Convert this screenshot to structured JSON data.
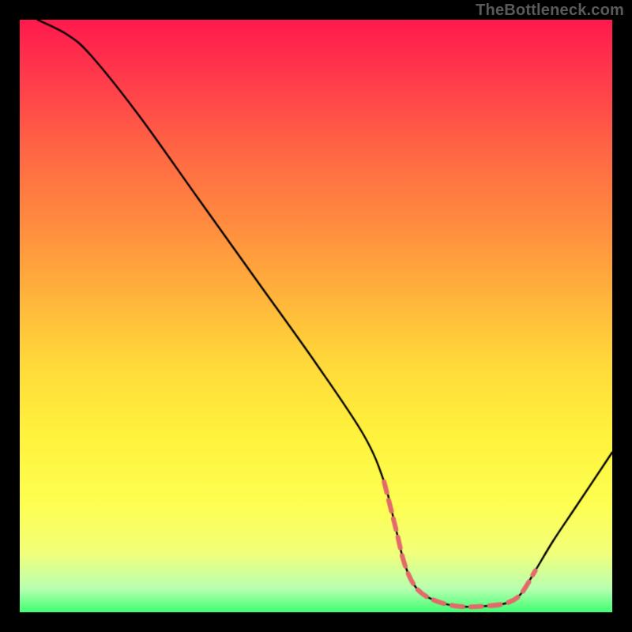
{
  "watermark": "TheBottleneck.com",
  "chart_data": {
    "type": "line",
    "title": "",
    "xlabel": "",
    "ylabel": "",
    "xlim": [
      0,
      100
    ],
    "ylim": [
      0,
      100
    ],
    "grid": false,
    "series": [
      {
        "name": "bottleneck-curve",
        "x": [
          3,
          8,
          12,
          20,
          30,
          40,
          50,
          58,
          61.5,
          63.5,
          65,
          67,
          70,
          74,
          78,
          82,
          84.5,
          87,
          90,
          94,
          100
        ],
        "y": [
          100,
          97.5,
          94,
          84,
          70,
          56,
          42,
          30,
          22,
          14,
          8,
          4,
          2,
          1,
          1,
          1.5,
          3,
          7,
          12,
          18,
          27
        ]
      }
    ],
    "dashed_band": {
      "name": "optimal-band",
      "x": [
        61.5,
        63.5,
        65,
        67,
        70,
        74,
        78,
        82,
        84.5,
        87
      ],
      "y": [
        22,
        14,
        8,
        4,
        2,
        1,
        1,
        1.5,
        3,
        7
      ],
      "color": "#e36a6a",
      "dash": [
        14,
        10
      ],
      "width": 6
    },
    "background_gradient": {
      "top": "#ff1a4d",
      "mid": "#ffd93a",
      "bottom": "#3fff73"
    }
  }
}
